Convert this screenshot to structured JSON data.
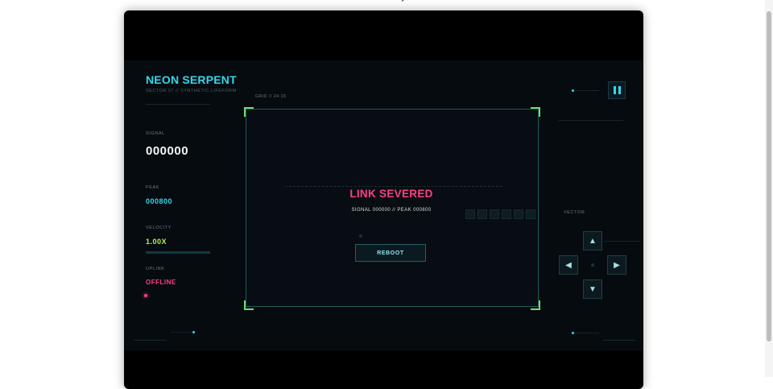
{
  "game": {
    "title": "NEON SERPENT",
    "subtitle": "SECTOR 07 // SYNTHETIC LIFEFORM",
    "grid_label": "GRID // 24:16"
  },
  "stats": {
    "signal_label": "SIGNAL",
    "signal_value": "000000",
    "peak_label": "PEAK",
    "peak_value": "000800",
    "velocity_label": "VELOCITY",
    "velocity_value": "1.00X",
    "uplink_label": "UPLINK",
    "uplink_value": "OFFLINE"
  },
  "overlay": {
    "title": "LINK SEVERED",
    "summary": "SIGNAL 000000 // PEAK 000800",
    "reboot_label": "REBOOT"
  },
  "controls": {
    "vector_label": "VECTOR",
    "up": "▲",
    "down": "▼",
    "left": "◀",
    "right": "▶",
    "pause_icon": "pause-icon"
  },
  "colors": {
    "accent": "#35d6ea",
    "alert": "#ff3f84",
    "velocity": "#b7ef4c",
    "corners": "#6ee06a",
    "background": "#060b10"
  }
}
